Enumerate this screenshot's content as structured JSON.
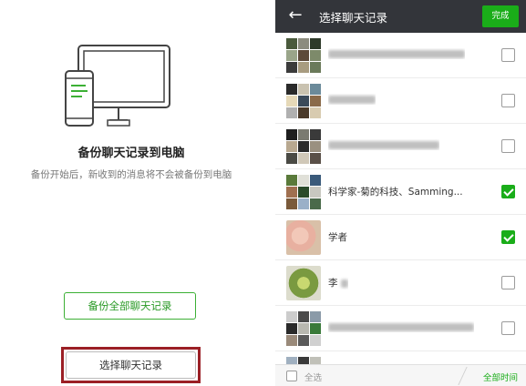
{
  "backup_panel": {
    "title": "备份聊天记录到电脑",
    "subtitle": "备份开始后，新收到的消息将不会被备份到电脑",
    "backup_all_button": "备份全部聊天记录",
    "select_button": "选择聊天记录",
    "illustration_icon": "desktop-and-phone-icon"
  },
  "select_panel": {
    "title": "选择聊天记录",
    "back_icon": "arrow-left-icon",
    "done_button": "完成",
    "chats": [
      {
        "name": "",
        "checked": false
      },
      {
        "name": "",
        "checked": false
      },
      {
        "name": "",
        "checked": false
      },
      {
        "name": "科学家-菊的科技、Samming...",
        "checked": true
      },
      {
        "name": "学者",
        "checked": true
      },
      {
        "name": "李",
        "checked": false
      },
      {
        "name": "",
        "checked": false
      }
    ],
    "select_all_label": "全选",
    "all_time_label": "全部时间"
  },
  "colors": {
    "accent_green": "#1aad19",
    "topbar_dark": "#33353a",
    "highlight_red": "#9b1f25"
  }
}
